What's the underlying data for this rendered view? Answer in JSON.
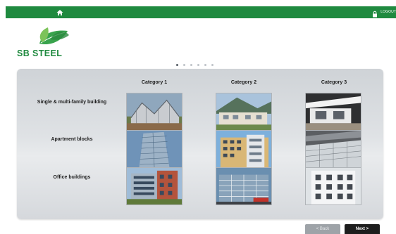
{
  "topbar": {
    "home_icon": "home-icon",
    "logout_label": "LOGOUT",
    "logout_icon": "lock-icon",
    "color": "#1f8a3f"
  },
  "logo": {
    "text": "SB STEEL",
    "icon": "leaf-logo",
    "color": "#1f8a3f"
  },
  "pager": {
    "count": 6,
    "active_index": 0
  },
  "grid": {
    "categories": [
      "Category 1",
      "Category 2",
      "Category 3"
    ],
    "rows": [
      {
        "label": "Single & multi-family building"
      },
      {
        "label": "Apartment blocks"
      },
      {
        "label": "Office buildings"
      }
    ]
  },
  "nav": {
    "back_label": "< Back",
    "next_label": "Next >"
  }
}
